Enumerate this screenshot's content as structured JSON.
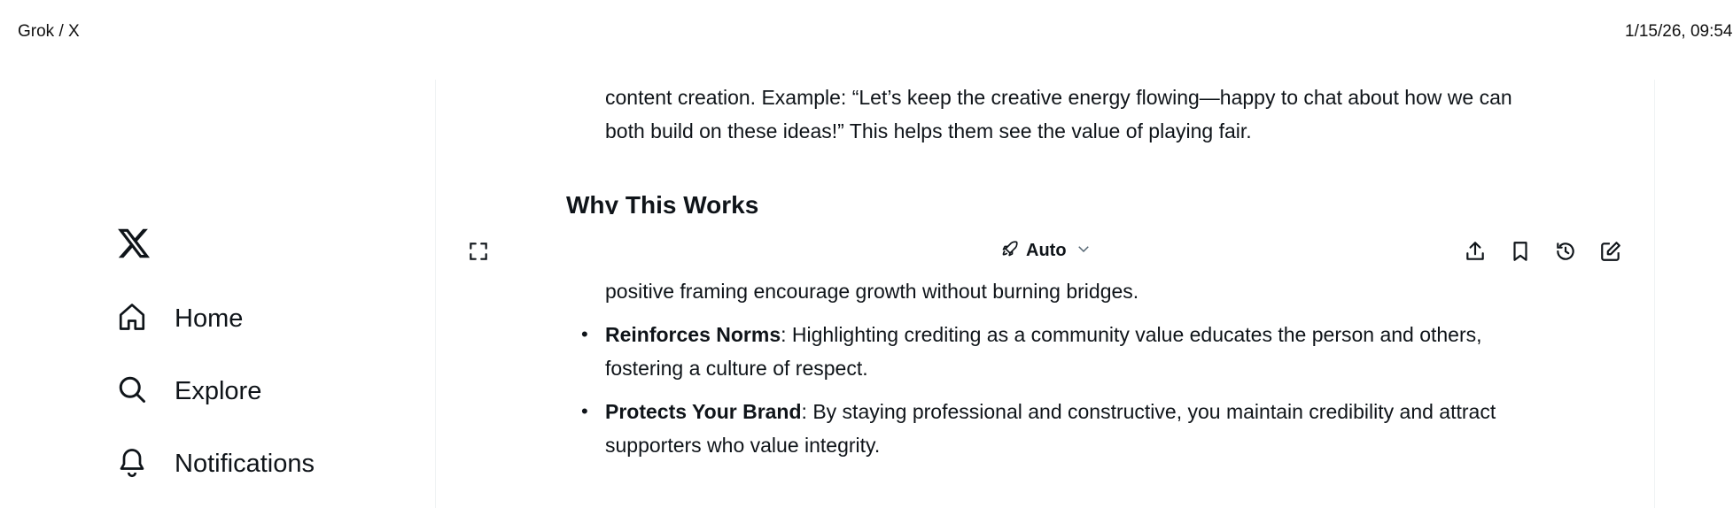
{
  "header": {
    "title": "Grok / X",
    "timestamp": "1/15/26, 09:54"
  },
  "nav": {
    "items": [
      {
        "label": "Home",
        "icon": "home-icon"
      },
      {
        "label": "Explore",
        "icon": "search-icon"
      },
      {
        "label": "Notifications",
        "icon": "bell-icon"
      }
    ]
  },
  "toolbar": {
    "mode_label": "Auto"
  },
  "content": {
    "top_para": "content creation. Example: “Let’s keep the creative energy flowing—happy to chat about how we can both build on these ideas!” This helps them see the value of playing fair.",
    "heading": "Why This Works",
    "partial_line": "positive framing encourage growth without burning bridges.",
    "bullets": [
      {
        "title": "Reinforces Norms",
        "text": ": Highlighting crediting as a community value educates the person and others, fostering a culture of respect."
      },
      {
        "title": "Protects Your Brand",
        "text": ": By staying professional and constructive, you maintain credibility and attract supporters who value integrity."
      }
    ]
  }
}
